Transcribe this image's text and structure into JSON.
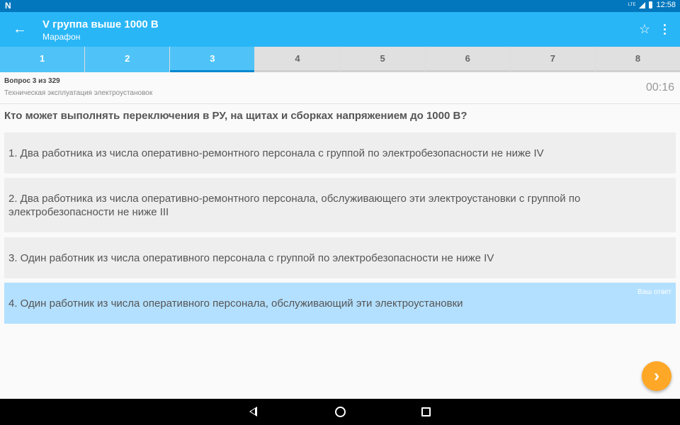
{
  "status_bar": {
    "logo": "N",
    "network": "LTE",
    "time": "12:58"
  },
  "app_bar": {
    "title": "V группа выше 1000 В",
    "subtitle": "Марафон",
    "back_icon": "arrow-left-icon",
    "star_icon": "star-icon",
    "more_icon": "more-vert-icon"
  },
  "tabs": [
    {
      "label": "1",
      "state": "done"
    },
    {
      "label": "2",
      "state": "done"
    },
    {
      "label": "3",
      "state": "active"
    },
    {
      "label": "4",
      "state": "pending"
    },
    {
      "label": "5",
      "state": "pending"
    },
    {
      "label": "6",
      "state": "pending"
    },
    {
      "label": "7",
      "state": "pending"
    },
    {
      "label": "8",
      "state": "pending"
    }
  ],
  "question_header": {
    "number": "Вопрос 3 из 329",
    "category": "Техническая эксплуатация электроустановок",
    "timer": "00:16"
  },
  "question": "Кто может выполнять переключения в РУ, на щитах и сборках напряжением до 1000 В?",
  "answers": [
    {
      "text": "1. Два работника из числа оперативно-ремонтного персонала с группой по электробезопасности не ниже IV"
    },
    {
      "text": "2. Два работника из числа оперативно-ремонтного персонала, обслуживающего эти электроустановки с группой по электробезопасности не ниже III"
    },
    {
      "text": "3. Один работник из числа оперативного персонала с группой по электробезопасности не ниже IV"
    },
    {
      "text": "4. Один работник из числа оперативного персонала, обслуживающий эти электроустановки",
      "badge": "Ваш ответ"
    }
  ],
  "fab": {
    "icon": "chevron-right-icon",
    "label": "›"
  },
  "colors": {
    "status_bar": "#0277bd",
    "app_bar": "#29b6f6",
    "tab_active": "#4fc3f7",
    "selected_answer": "#b3e0ff",
    "fab": "#ffa726"
  }
}
